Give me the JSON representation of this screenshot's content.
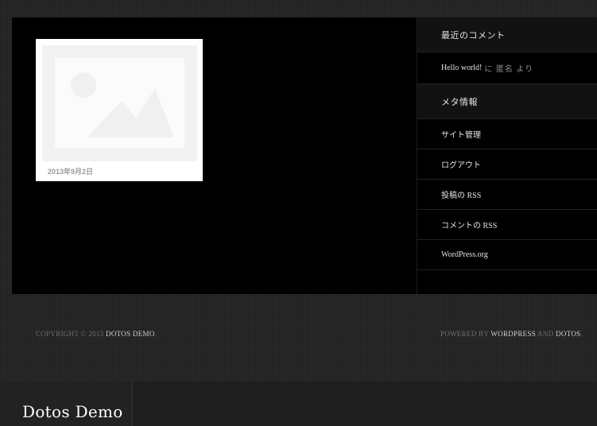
{
  "post": {
    "date": "2013年9月2日"
  },
  "sidebar": {
    "recent_comments_title": "最近のコメント",
    "recent_comment": {
      "post_link": "Hello world!",
      "suffix": "に 匿名 より"
    },
    "meta_title": "メタ情報",
    "meta_items": [
      {
        "label": "サイト管理"
      },
      {
        "label": "ログアウト"
      },
      {
        "label": "投稿の RSS"
      },
      {
        "label": "コメントの RSS"
      },
      {
        "label": "WordPress.org"
      }
    ]
  },
  "footer": {
    "copyright_prefix": "Copyright © 2013",
    "site_link": "Dotos Demo",
    "copyright_suffix": ".",
    "powered_by": "Powered by",
    "wordpress_link": "WordPress",
    "and": "and",
    "theme_link": "Dotos",
    "credit_suffix": "."
  },
  "site": {
    "title": "Dotos Demo"
  }
}
